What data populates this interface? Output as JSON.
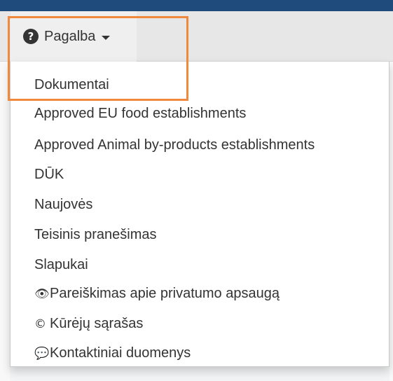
{
  "colors": {
    "top_bar": "#1e4a7c",
    "navbar_bg": "#e7e7e7",
    "highlight": "#f0883e",
    "menu_text": "#333333"
  },
  "navbar": {
    "help_label": "Pagalba",
    "help_icon": "question-circle-icon"
  },
  "menu": {
    "items": [
      {
        "label": "Dokumentai"
      },
      {
        "label": "Approved EU food establishments"
      },
      {
        "label": "Approved Animal by-products establishments"
      },
      {
        "label": "DŪK"
      },
      {
        "label": "Naujovės"
      },
      {
        "label": "Teisinis pranešimas"
      },
      {
        "label": "Slapukai"
      },
      {
        "label": "Pareiškimas apie privatumo apsaugą",
        "icon": "eye-icon"
      },
      {
        "label": "Kūrėjų sąrašas",
        "icon": "copyright-icon"
      },
      {
        "label": "Kontaktiniai duomenys",
        "icon": "comment-icon"
      }
    ]
  }
}
